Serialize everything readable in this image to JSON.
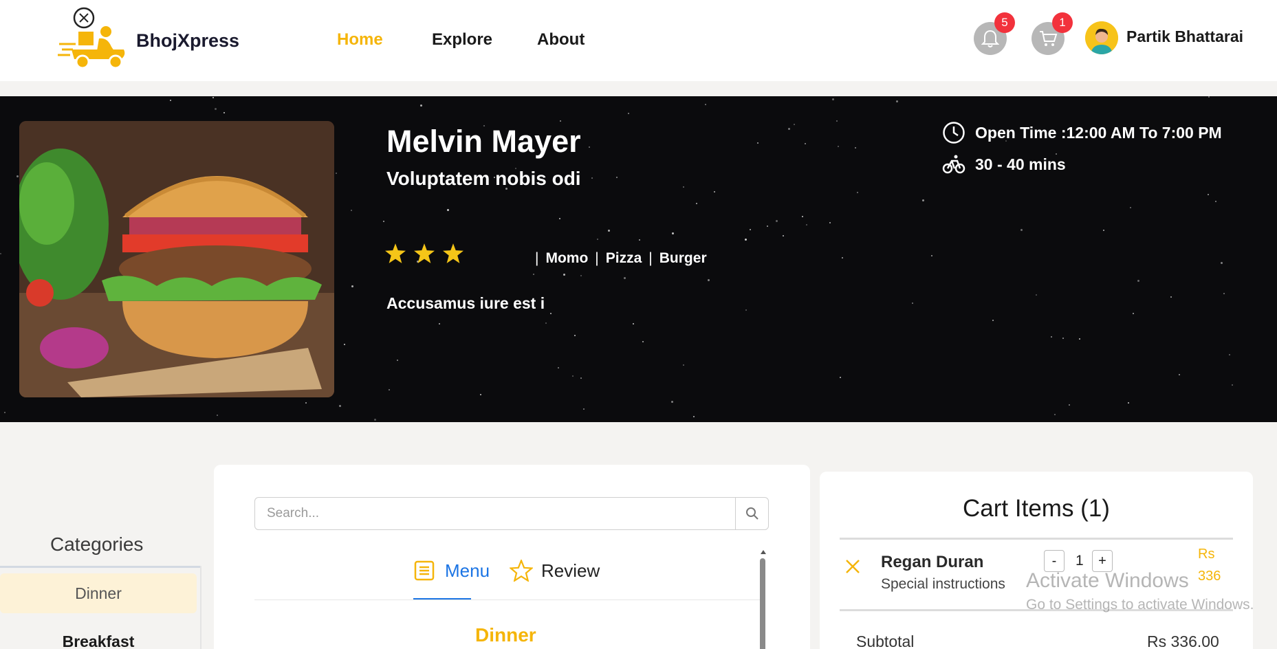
{
  "header": {
    "brand": "BhojXpress",
    "nav": [
      {
        "label": "Home",
        "active": true
      },
      {
        "label": "Explore",
        "active": false
      },
      {
        "label": "About",
        "active": false
      }
    ],
    "notifications_count": "5",
    "cart_count": "1",
    "user_name": "Partik Bhattarai"
  },
  "restaurant": {
    "name": "Melvin Mayer",
    "subtitle": "Voluptatem nobis odi",
    "rating": 3,
    "tags": [
      "Momo",
      "Pizza",
      "Burger"
    ],
    "description": "Accusamus iure est i",
    "open_time": "Open Time :12:00 AM To 7:00 PM",
    "delivery_time": "30 - 40 mins"
  },
  "sidebar": {
    "title": "Categories",
    "items": [
      {
        "label": "Dinner",
        "active": true
      },
      {
        "label": "Breakfast",
        "active": false
      }
    ]
  },
  "menu": {
    "search_placeholder": "Search...",
    "tabs": [
      {
        "label": "Menu",
        "active": true
      },
      {
        "label": "Review",
        "active": false
      }
    ],
    "section_title": "Dinner"
  },
  "cart": {
    "title": "Cart Items (1)",
    "items": [
      {
        "name": "Regan Duran",
        "note": "Special instructions",
        "qty": "1",
        "price_currency": "Rs",
        "price_value": "336"
      }
    ],
    "subtotal_label": "Subtotal",
    "subtotal_value": "Rs 336.00"
  },
  "overlay": {
    "watermark_title": "Activate Windows",
    "watermark_sub": "Go to Settings to activate Windows."
  },
  "colors": {
    "accent": "#f5b50a",
    "link": "#1b74e4",
    "badge": "#f2323c",
    "hero_bg": "#0b0b0d"
  }
}
